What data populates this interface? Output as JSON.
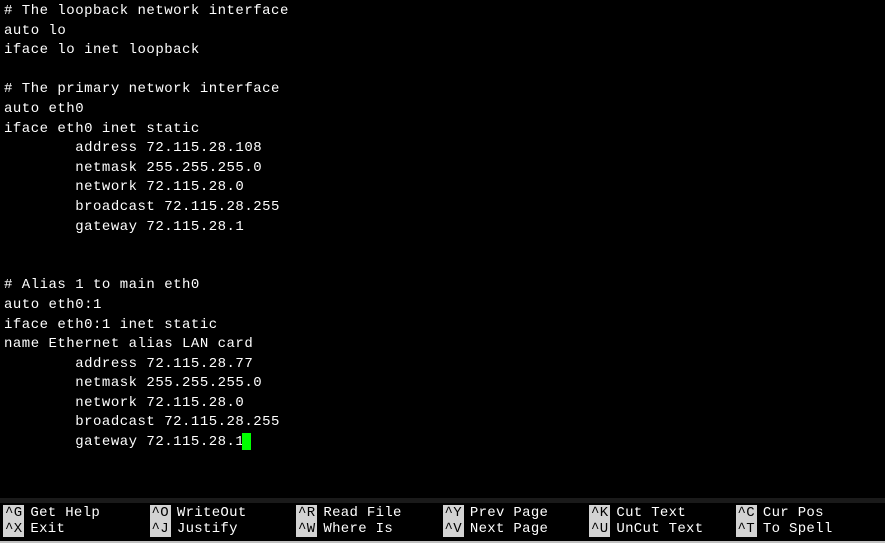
{
  "file_lines": [
    "# The loopback network interface",
    "auto lo",
    "iface lo inet loopback",
    "",
    "# The primary network interface",
    "auto eth0",
    "iface eth0 inet static",
    "        address 72.115.28.108",
    "        netmask 255.255.255.0",
    "        network 72.115.28.0",
    "        broadcast 72.115.28.255",
    "        gateway 72.115.28.1",
    "",
    "",
    "# Alias 1 to main eth0",
    "auto eth0:1",
    "iface eth0:1 inet static",
    "name Ethernet alias LAN card",
    "        address 72.115.28.77",
    "        netmask 255.255.255.0",
    "        network 72.115.28.0",
    "        broadcast 72.115.28.255",
    "        gateway 72.115.28.1"
  ],
  "cursor_line_index": 22,
  "shortcuts": [
    {
      "key": "^G",
      "label": "Get Help"
    },
    {
      "key": "^O",
      "label": "WriteOut"
    },
    {
      "key": "^R",
      "label": "Read File"
    },
    {
      "key": "^Y",
      "label": "Prev Page"
    },
    {
      "key": "^K",
      "label": "Cut Text"
    },
    {
      "key": "^C",
      "label": "Cur Pos"
    },
    {
      "key": "^X",
      "label": "Exit"
    },
    {
      "key": "^J",
      "label": "Justify"
    },
    {
      "key": "^W",
      "label": "Where Is"
    },
    {
      "key": "^V",
      "label": "Next Page"
    },
    {
      "key": "^U",
      "label": "UnCut Text"
    },
    {
      "key": "^T",
      "label": "To Spell"
    }
  ]
}
